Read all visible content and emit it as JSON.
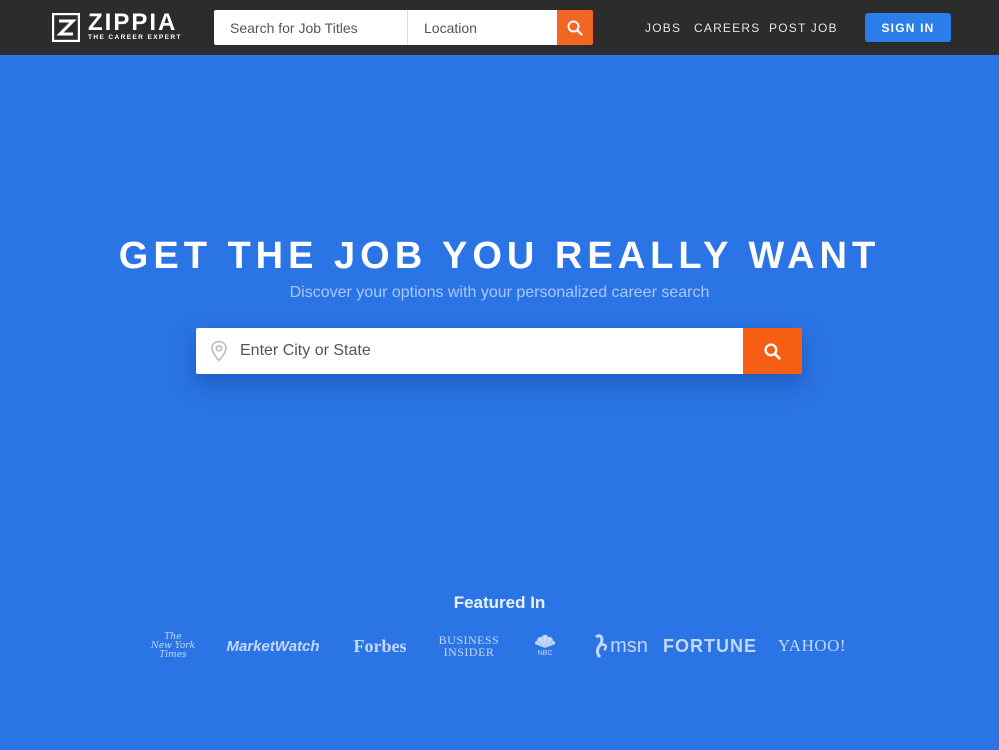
{
  "brand": {
    "name": "ZIPPIA",
    "tagline": "THE CAREER EXPERT"
  },
  "header": {
    "job_search_placeholder": "Search for Job Titles",
    "location_placeholder": "Location",
    "nav": [
      {
        "label": "JOBS"
      },
      {
        "label": "CAREERS"
      },
      {
        "label": "POST JOB"
      }
    ],
    "sign_in_label": "SIGN IN",
    "search_icon": "search-icon"
  },
  "hero": {
    "title": "GET THE JOB YOU REALLY WANT",
    "subtitle": "Discover your options with your personalized career search",
    "search_placeholder": "Enter City or State",
    "location_icon": "map-pin-icon",
    "search_icon": "search-icon"
  },
  "featured": {
    "title": "Featured In",
    "outlets": [
      {
        "name": "The New York Times",
        "lines": [
          "The",
          "New York",
          "Times"
        ]
      },
      {
        "name": "MarketWatch"
      },
      {
        "name": "Forbes"
      },
      {
        "name": "Business Insider",
        "lines": [
          "BUSINESS",
          "INSIDER"
        ]
      },
      {
        "name": "NBC"
      },
      {
        "name": "msn"
      },
      {
        "name": "FORTUNE"
      },
      {
        "name": "YAHOO!"
      }
    ]
  },
  "colors": {
    "background": "#2b74e6",
    "topbar": "#2c2c2c",
    "accent_orange": "#f65e14",
    "signin_blue": "#2b7de9"
  }
}
